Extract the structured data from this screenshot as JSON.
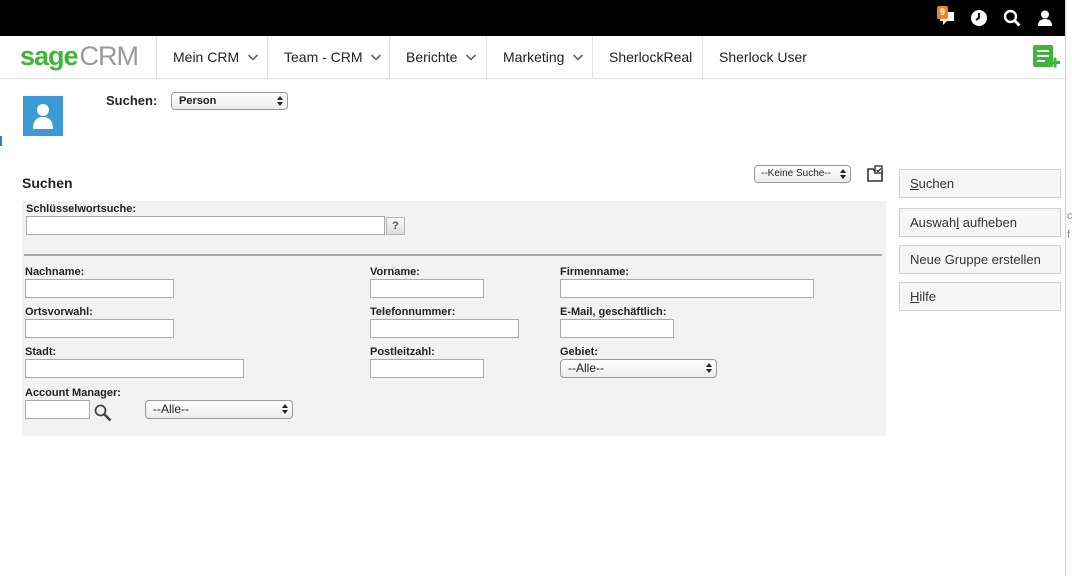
{
  "topbar": {
    "notification_count": "9",
    "icons": [
      "notification-icon",
      "clock-icon",
      "search-icon",
      "user-icon"
    ]
  },
  "nav": {
    "logo_sage": "sage",
    "logo_crm": "CRM",
    "items": [
      {
        "label": "Mein CRM",
        "dropdown": true
      },
      {
        "label": "Team - CRM",
        "dropdown": true
      },
      {
        "label": "Berichte",
        "dropdown": true
      },
      {
        "label": "Marketing",
        "dropdown": true
      },
      {
        "label": "SherlockReal",
        "dropdown": false
      },
      {
        "label": "Sherlock User",
        "dropdown": false
      }
    ]
  },
  "header": {
    "search_label": "Suchen:",
    "entity_select": "Person",
    "saved_search_select": "--Keine Suche--"
  },
  "form": {
    "title": "Suchen",
    "keyword_label": "Schlüsselwortsuche:",
    "keyword_value": "",
    "help_button": "?",
    "fields": {
      "nachname": "Nachname:",
      "vorname": "Vorname:",
      "firmenname": "Firmenname:",
      "ortsvorwahl": "Ortsvorwahl:",
      "telefonnummer": "Telefonnummer:",
      "email": "E-Mail, geschäftlich:",
      "stadt": "Stadt:",
      "postleitzahl": "Postleitzahl:",
      "gebiet": "Gebiet:",
      "account_manager": "Account Manager:"
    },
    "gebiet_select": "--Alle--",
    "account_manager_select": "--Alle--"
  },
  "side_buttons": {
    "suchen_first": "S",
    "suchen_rest": "uchen",
    "auswahl_pre": "Auswah",
    "auswahl_ul": "l",
    "auswahl_post": " aufheben",
    "neue_gruppe": "Neue Gruppe erstellen",
    "hilfe_first": "H",
    "hilfe_rest": "ilfe"
  },
  "right_edge_text": {
    "line1": "ch",
    "line2": "f"
  },
  "colors": {
    "sage_green": "#41b33b",
    "topbar": "#000000",
    "avatar_blue": "#3a9ad6",
    "badge_orange": "#e8852a",
    "panel_bg": "#f2f2f2"
  }
}
